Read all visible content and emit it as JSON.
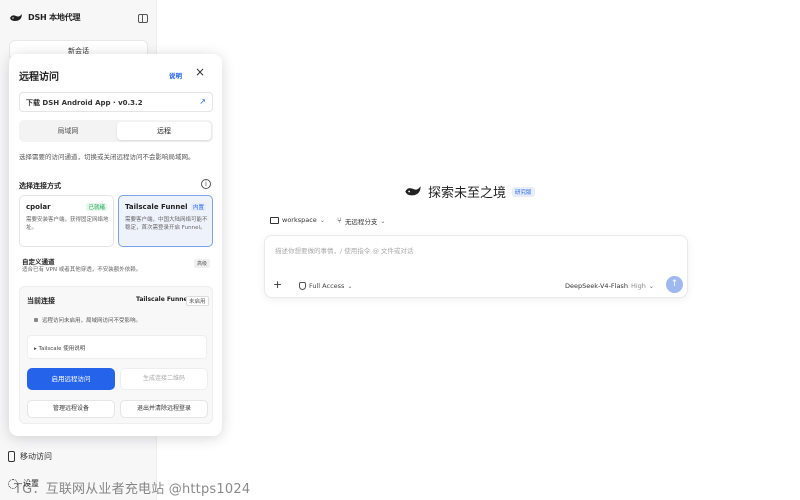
{
  "sidebar": {
    "brand_name": "DSH 本地代理",
    "new_chat_label": "新会话",
    "mobile_access_label": "移动访问",
    "settings_label": "设置"
  },
  "modal": {
    "title": "远程访问",
    "help_link": "说明",
    "close_label": "×",
    "download_label": "下载 DSH Android App · v0.3.2",
    "tabs": [
      {
        "label": "局域网"
      },
      {
        "label": "远程"
      }
    ],
    "description": "选择需要的访问通道，切换或关闭远程访问不会影响局域网。",
    "method_section_title": "选择连接方式",
    "options": [
      {
        "name": "cpolar",
        "badge": "已就绪",
        "desc": "需要安装客户端，获得固定网络地址。"
      },
      {
        "name": "Tailscale Funnel",
        "badge": "内置",
        "desc": "需要客户端，中国大陆网络可能不稳定，首次需登录开启 Funnel。"
      }
    ],
    "custom": {
      "title": "自定义通道",
      "desc": "适合已有 VPN 或者其他穿透，不安装额外依赖。",
      "tag": "高级"
    },
    "connection": {
      "title": "当前连接",
      "provider": "Tailscale Funnel",
      "state": "未启用",
      "message": "远程访问未启用，局域网访问不受影响。",
      "tutorial": "▸ Tailscale 使用说明",
      "start_button": "启用远程访问",
      "qr_button": "生成连接二维码",
      "manage_button": "管理远程设备",
      "logout_button": "退出并清除远程登录"
    }
  },
  "main": {
    "hero_title": "探索未至之境",
    "hero_badge": "研究版",
    "workspace_chip": "workspace",
    "branch_chip": "无远程分支",
    "input_placeholder": "描述你想要做的事情，/ 使用指令 @ 文件或对话",
    "access_label": "Full Access",
    "model_name": "DeepSeek-V4-Flash",
    "model_level": "High",
    "send_icon": "↑"
  },
  "watermark": "TG：互联网从业者充电站 @https1024",
  "colors": {
    "accent": "#2563eb",
    "selected_card_bg": "#eef3fb",
    "ready_green": "#16a34a"
  },
  "icons": {
    "brand": "whale-icon",
    "sidebar_toggle": "sidebar-toggle-icon",
    "external": "external-link-icon",
    "info": "info-icon",
    "folder": "folder-icon",
    "branch": "branch-icon",
    "shield": "shield-icon",
    "plus": "plus-icon",
    "send": "arrow-up-icon"
  }
}
